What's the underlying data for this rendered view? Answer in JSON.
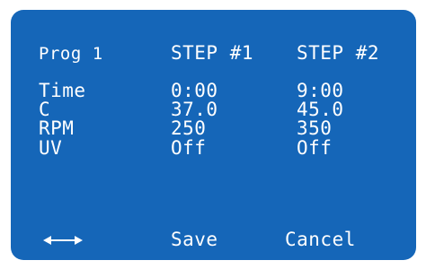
{
  "header": {
    "program": "Prog 1",
    "step1": "STEP #1",
    "step2": "STEP #2"
  },
  "rows": [
    {
      "label": "Time",
      "step1": "0:00",
      "step2": "9:00"
    },
    {
      "label": "C",
      "step1": "37.0",
      "step2": "45.0"
    },
    {
      "label": "RPM",
      "step1": "250",
      "step2": "350"
    },
    {
      "label": "UV",
      "step1": "Off",
      "step2": "Off"
    }
  ],
  "footer": {
    "navigate_icon": "left-right-arrows",
    "save_label": "Save",
    "cancel_label": "Cancel"
  },
  "colors": {
    "background": "#1566b8",
    "text": "#ffffff"
  }
}
